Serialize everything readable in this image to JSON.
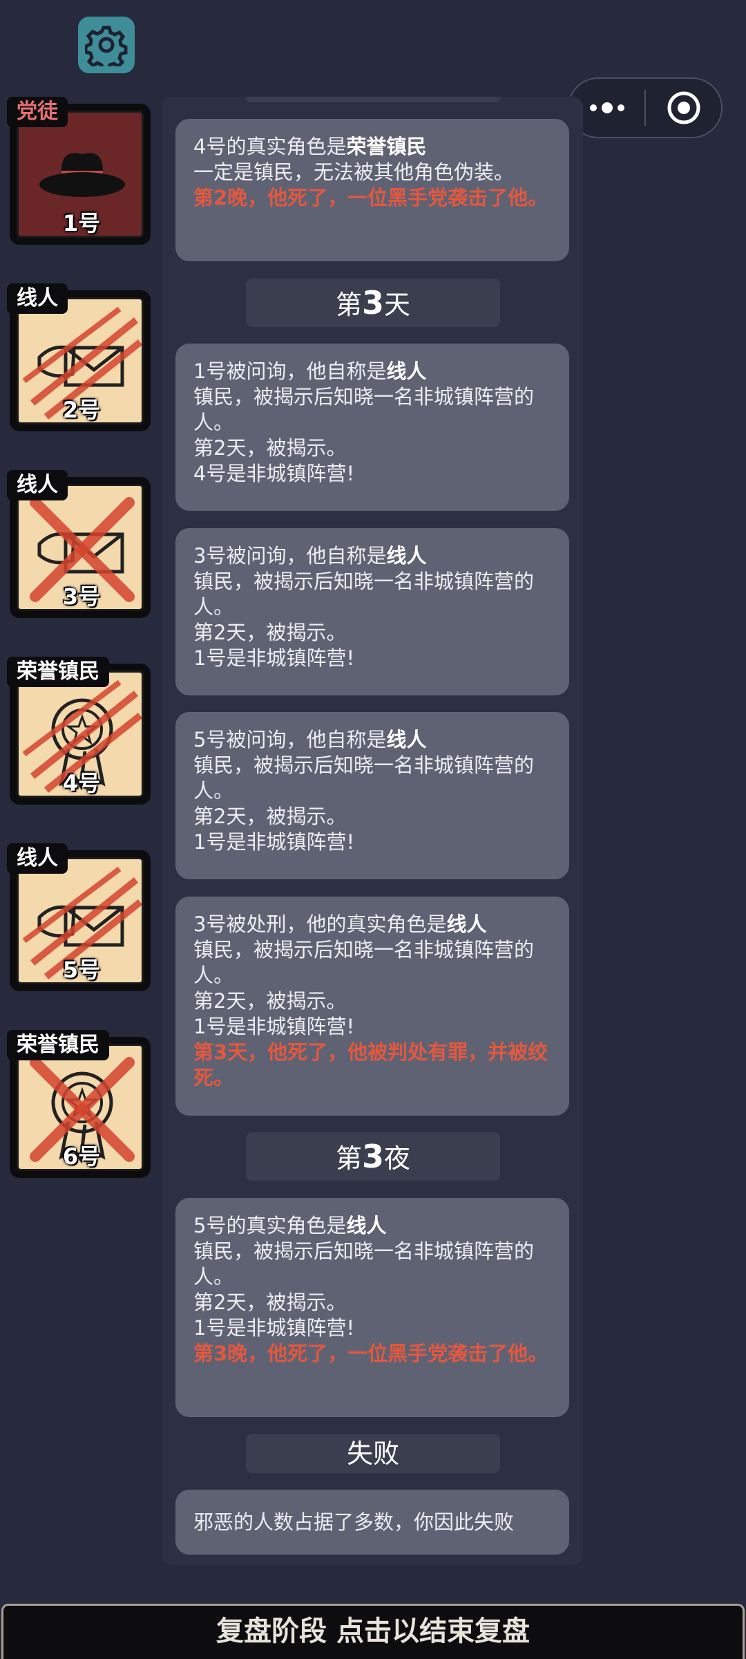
{
  "roles": [
    {
      "tag": "党徒",
      "number": "1号"
    },
    {
      "tag": "线人",
      "number": "2号"
    },
    {
      "tag": "线人",
      "number": "3号"
    },
    {
      "tag": "荣誉镇民",
      "number": "4号"
    },
    {
      "tag": "线人",
      "number": "5号"
    },
    {
      "tag": "荣誉镇民",
      "number": "6号"
    }
  ],
  "log": {
    "card1": {
      "l1a": "4号的真实角色是",
      "l1b": "荣誉镇民",
      "l2": "一定是镇民，无法被其他角色伪装。",
      "red": "第2晚，他死了，一位黑手党袭击了他。"
    },
    "day3": {
      "pre": "第",
      "num": "3",
      "post": "天"
    },
    "card2": {
      "l1a": "1号被问询，他自称是",
      "l1b": "线人",
      "l2": "镇民，被揭示后知晓一名非城镇阵营的人。",
      "l3": "第2天，被揭示。",
      "l4": "4号是非城镇阵营!"
    },
    "card3": {
      "l1a": "3号被问询，他自称是",
      "l1b": "线人",
      "l2": "镇民，被揭示后知晓一名非城镇阵营的人。",
      "l3": "第2天，被揭示。",
      "l4": "1号是非城镇阵营!"
    },
    "card4": {
      "l1a": "5号被问询，他自称是",
      "l1b": "线人",
      "l2": "镇民，被揭示后知晓一名非城镇阵营的人。",
      "l3": "第2天，被揭示。",
      "l4": "1号是非城镇阵营!"
    },
    "card5": {
      "l1a": "3号被处刑，他的真实角色是",
      "l1b": "线人",
      "l2": "镇民，被揭示后知晓一名非城镇阵营的人。",
      "l3": "第2天，被揭示。",
      "l4": "1号是非城镇阵营!",
      "red": "第3天，他死了，他被判处有罪，并被绞死。"
    },
    "night3": {
      "pre": "第",
      "num": "3",
      "post": "夜"
    },
    "card6": {
      "l1a": "5号的真实角色是",
      "l1b": "线人",
      "l2": "镇民，被揭示后知晓一名非城镇阵营的人。",
      "l3": "第2天，被揭示。",
      "l4": "1号是非城镇阵营!",
      "red": "第3晚，他死了，一位黑手党袭击了他。"
    },
    "result_header": "失败",
    "card7": {
      "l1": "邪恶的人数占据了多数，你因此失败"
    }
  },
  "bottom_bar": "复盘阶段 点击以结束复盘",
  "colors": {
    "accent_red": "#e3583f",
    "card": "#5f6273",
    "background": "#262a3c"
  }
}
